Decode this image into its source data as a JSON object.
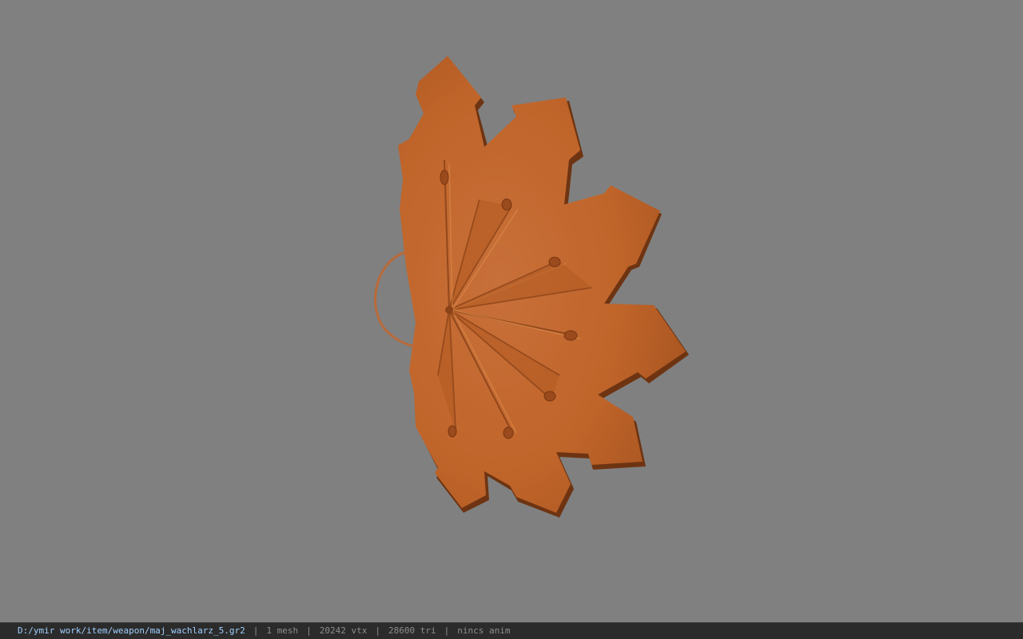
{
  "viewport": {
    "background_color": "#808080",
    "model_color": "#c0652a",
    "model_shadow_color": "#6e3412",
    "model_highlight_color": "#d98848",
    "model_name": "maj_wachlarz_5"
  },
  "status_bar": {
    "file_path": "D:/ymir work/item/weapon/maj_wachlarz_5.gr2",
    "separator": "|",
    "mesh_count": "1 mesh",
    "vertex_count": "20242 vtx",
    "triangle_count": "28600 tri",
    "anim_info": "nincs anim",
    "path_color": "#9fd0ff",
    "text_color": "#8e8e8e",
    "background_color": "#2b2b2b"
  }
}
